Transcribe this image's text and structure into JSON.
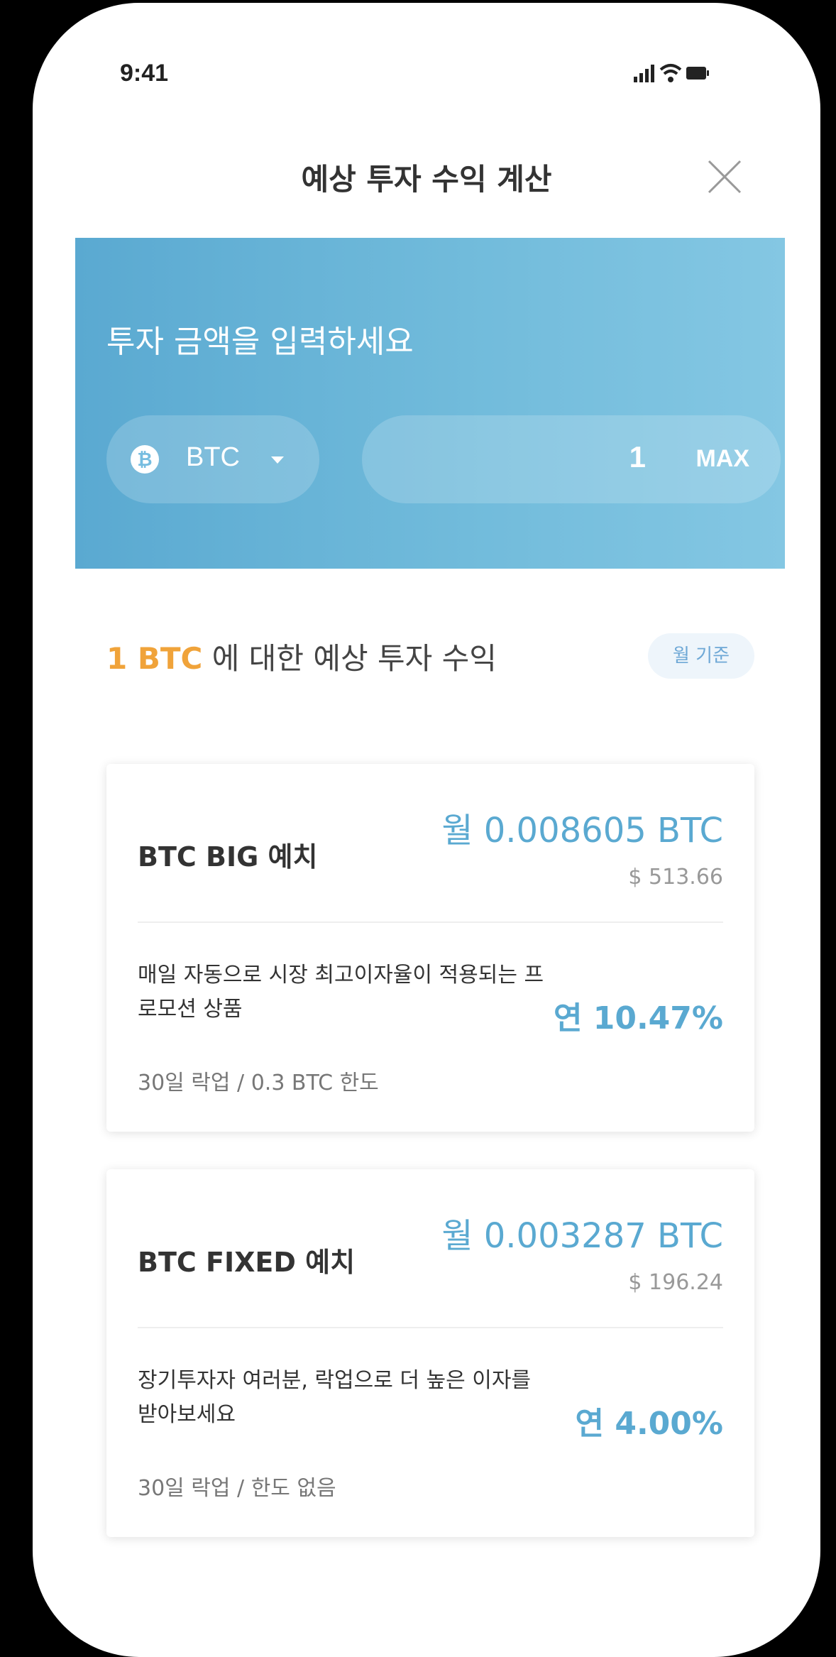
{
  "status_bar": {
    "time": "9:41"
  },
  "header": {
    "title": "예상 투자 수익 계산"
  },
  "banner": {
    "title": "투자 금액을 입력하세요",
    "coin": "BTC",
    "amount": "1",
    "max_label": "MAX"
  },
  "summary": {
    "amount_prefix": "1 BTC",
    "heading_suffix": " 에 대한 예상 투자 수익",
    "basis_badge": "월 기준"
  },
  "products": [
    {
      "name": "BTC BIG 예치",
      "monthly": "월 0.008605 BTC",
      "usd": "$ 513.66",
      "description": "매일 자동으로 시장 최고이자율이 적용되는 프로모션 상품",
      "terms": "30일 락업 / 0.3 BTC 한도",
      "annual_rate": "연 10.47%"
    },
    {
      "name": "BTC FIXED 예치",
      "monthly": "월 0.003287 BTC",
      "usd": "$ 196.24",
      "description": "장기투자자 여러분, 락업으로 더 높은 이자를 받아보세요",
      "terms": "30일 락업 / 한도 없음",
      "annual_rate": "연 4.00%"
    }
  ],
  "colors": {
    "accent_blue": "#5aa9d1",
    "accent_orange": "#f0a33a"
  },
  "icons": [
    "signal-icon",
    "wifi-icon",
    "battery-icon",
    "close-icon",
    "bitcoin-icon",
    "caret-down-icon"
  ]
}
